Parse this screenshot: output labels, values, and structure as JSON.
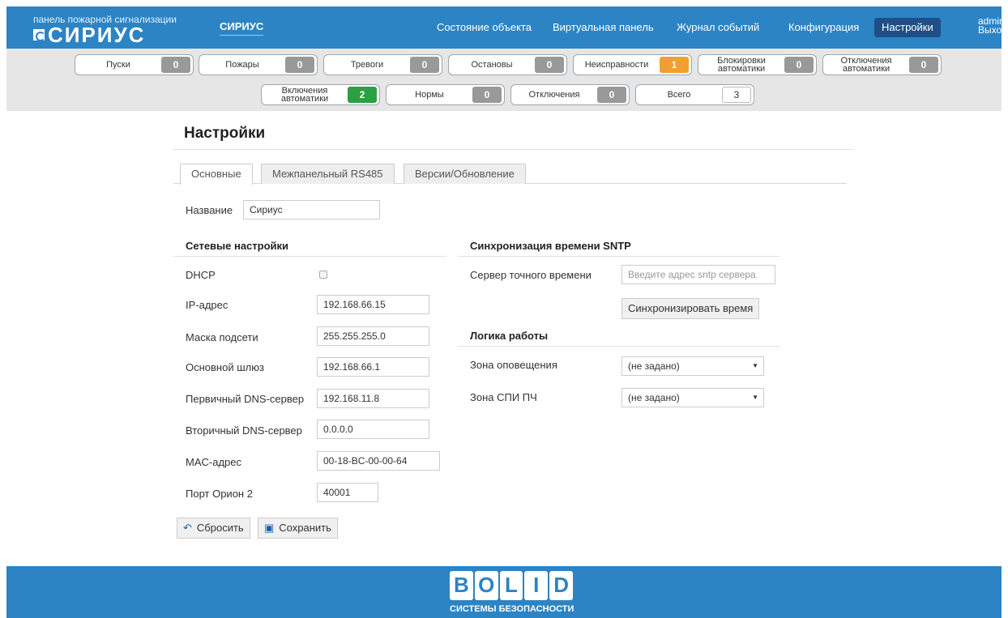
{
  "header": {
    "small_title": "панель пожарной сигнализации",
    "logo": "СИРИУС",
    "brand": "СИРИУС",
    "nav": [
      {
        "label": "Состояние объекта"
      },
      {
        "label": "Виртуальная панель"
      },
      {
        "label": "Журнал событий"
      },
      {
        "label": "Конфигурация"
      },
      {
        "label": "Настройки"
      }
    ],
    "active_nav": "Настройки",
    "user": "admin",
    "logout": "Выход"
  },
  "counters": [
    {
      "label": "Пуски",
      "value": "0",
      "color": "gray"
    },
    {
      "label": "Пожары",
      "value": "0",
      "color": "gray"
    },
    {
      "label": "Тревоги",
      "value": "0",
      "color": "gray"
    },
    {
      "label": "Остановы",
      "value": "0",
      "color": "gray"
    },
    {
      "label": "Неисправности",
      "value": "1",
      "color": "orange"
    },
    {
      "label": "Блокировки\nавтоматики",
      "value": "0",
      "color": "gray"
    },
    {
      "label": "Отключения\nавтоматики",
      "value": "0",
      "color": "gray"
    },
    {
      "label": "Включения\nавтоматики",
      "value": "2",
      "color": "green"
    },
    {
      "label": "Нормы",
      "value": "0",
      "color": "gray"
    },
    {
      "label": "Отключения",
      "value": "0",
      "color": "gray"
    },
    {
      "label": "Всего",
      "value": "3",
      "color": "white"
    }
  ],
  "page": {
    "title": "Настройки",
    "tabs": [
      "Основные",
      "Межпанельный RS485",
      "Версии/Обновление"
    ],
    "active_tab": "Основные"
  },
  "name_field": {
    "label": "Название",
    "value": "Сириус"
  },
  "network": {
    "title": "Сетевые настройки",
    "dhcp_label": "DHCP",
    "dhcp_checked": false,
    "ip_label": "IP-адрес",
    "ip": "192.168.66.15",
    "mask_label": "Маска подсети",
    "mask": "255.255.255.0",
    "gateway_label": "Основной шлюз",
    "gateway": "192.168.66.1",
    "dns1_label": "Первичный DNS-сервер",
    "dns1": "192.168.11.8",
    "dns2_label": "Вторичный DNS-сервер",
    "dns2": "0.0.0.0",
    "mac_label": "MAC-адрес",
    "mac": "00-18-BC-00-00-64",
    "port_label": "Порт Орион 2",
    "port": "40001"
  },
  "sntp": {
    "title": "Синхронизация времени SNTP",
    "server_label": "Сервер точного времени",
    "server_placeholder": "Введите адрес sntp сервера",
    "sync_button": "Синхронизировать время"
  },
  "logic": {
    "title": "Логика работы",
    "zone_alert_label": "Зона оповещения",
    "zone_alert_value": "(не задано)",
    "zone_spi_label": "Зона СПИ ПЧ",
    "zone_spi_value": "(не задано)"
  },
  "actions": {
    "reset": "Сбросить",
    "save": "Сохранить"
  },
  "footer": {
    "logo": "BOLID",
    "tagline": "СИСТЕМЫ БЕЗОПАСНОСТИ"
  },
  "colors": {
    "header_bg": "#2c84c4",
    "active_nav_bg": "#1f4f86",
    "warning": "#f0a030",
    "ok": "#2aa040"
  }
}
